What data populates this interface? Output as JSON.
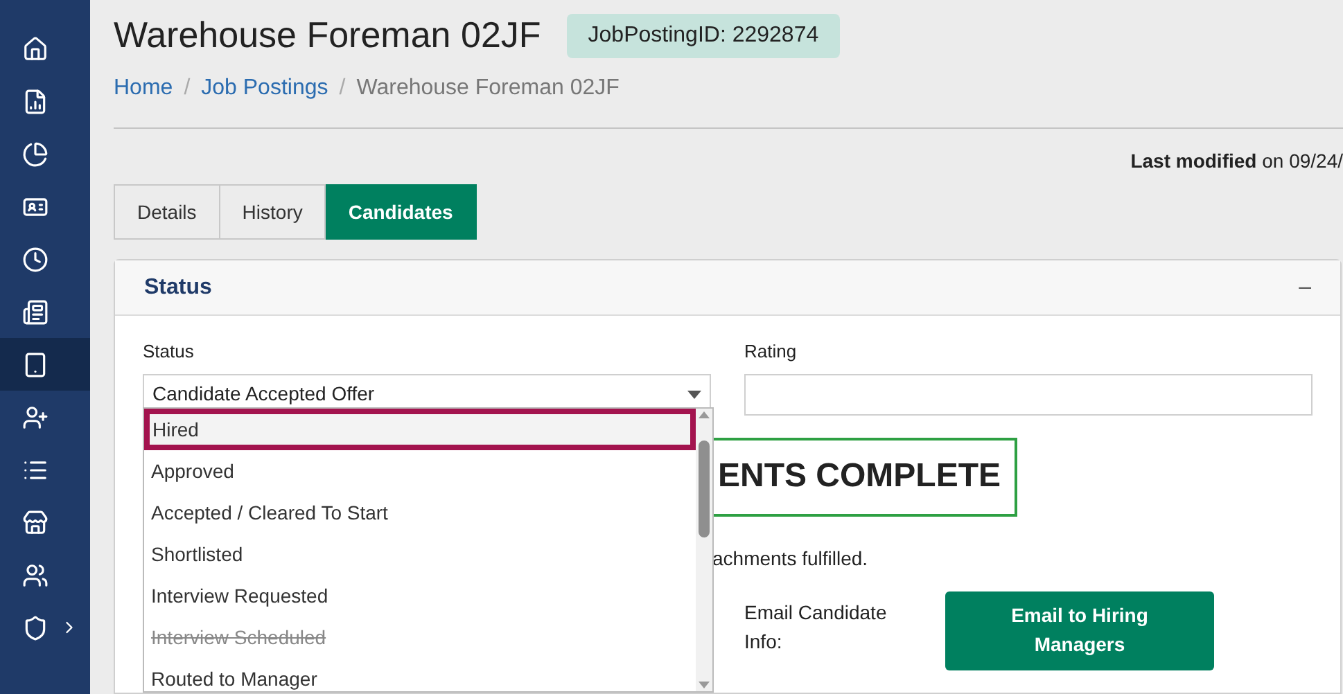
{
  "sidebar": {
    "items": [
      {
        "selected": false,
        "has_submenu": false
      },
      {
        "selected": false,
        "has_submenu": false
      },
      {
        "selected": false,
        "has_submenu": false
      },
      {
        "selected": false,
        "has_submenu": false
      },
      {
        "selected": false,
        "has_submenu": false
      },
      {
        "selected": false,
        "has_submenu": false
      },
      {
        "selected": true,
        "has_submenu": false
      },
      {
        "selected": false,
        "has_submenu": false
      },
      {
        "selected": false,
        "has_submenu": false
      },
      {
        "selected": false,
        "has_submenu": false
      },
      {
        "selected": false,
        "has_submenu": false
      },
      {
        "selected": false,
        "has_submenu": true
      }
    ]
  },
  "header": {
    "title": "Warehouse Foreman 02JF",
    "badge": "JobPostingID: 2292874"
  },
  "breadcrumb": {
    "separators": [
      "/",
      "/"
    ],
    "items": [
      {
        "label": "Home",
        "link": true
      },
      {
        "label": "Job Postings",
        "link": true
      },
      {
        "label": "Warehouse Foreman 02JF",
        "link": false
      }
    ]
  },
  "last_modified": {
    "label": "Last modified",
    "text": "on 09/24/"
  },
  "tabs": [
    {
      "label": "Details",
      "selected": false
    },
    {
      "label": "History",
      "selected": false
    },
    {
      "label": "Candidates",
      "selected": true
    }
  ],
  "panel": {
    "title": "Status",
    "collapse": "–",
    "status_field": {
      "label": "Status",
      "value": "Candidate Accepted Offer"
    },
    "rating_field": {
      "label": "Rating"
    },
    "dropdown": {
      "options": [
        {
          "label": "Hired",
          "selected": true,
          "disabled": false
        },
        {
          "label": "Approved",
          "selected": false,
          "disabled": false
        },
        {
          "label": "Accepted / Cleared To Start",
          "selected": false,
          "disabled": false
        },
        {
          "label": "Shortlisted",
          "selected": false,
          "disabled": false
        },
        {
          "label": "Interview Requested",
          "selected": false,
          "disabled": false
        },
        {
          "label": "Interview Scheduled",
          "selected": false,
          "disabled": true
        },
        {
          "label": "Routed to Manager",
          "selected": false,
          "disabled": false
        }
      ]
    },
    "banner": "ENTS COMPLETE",
    "note": "achments fulfilled.",
    "email_label": "Email Candidate Info:",
    "email_button": "Email to Hiring Managers"
  }
}
